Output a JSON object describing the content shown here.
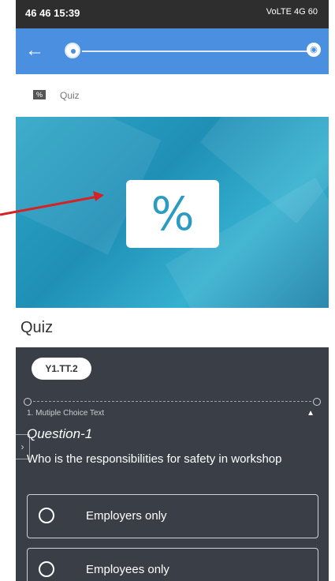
{
  "status": {
    "left": "46 46 15:39",
    "right": "VoLTE 4G 60"
  },
  "app": {
    "back_icon": "back-arrow-icon"
  },
  "breadcrumb": {
    "label": "Quiz"
  },
  "banner": {
    "symbol": "%"
  },
  "title": "Quiz",
  "tag": "Y1.TT.2",
  "question": {
    "type_label": "1. Mutiple Choice Text",
    "title": "Question-1",
    "text": "Who is the responsibilities for safety in workshop",
    "options": [
      "Employers only",
      "Employees only"
    ]
  },
  "colors": {
    "appbar": "#4a8fe0",
    "body": "#3a3f47",
    "annotation_arrow": "#d62222"
  }
}
